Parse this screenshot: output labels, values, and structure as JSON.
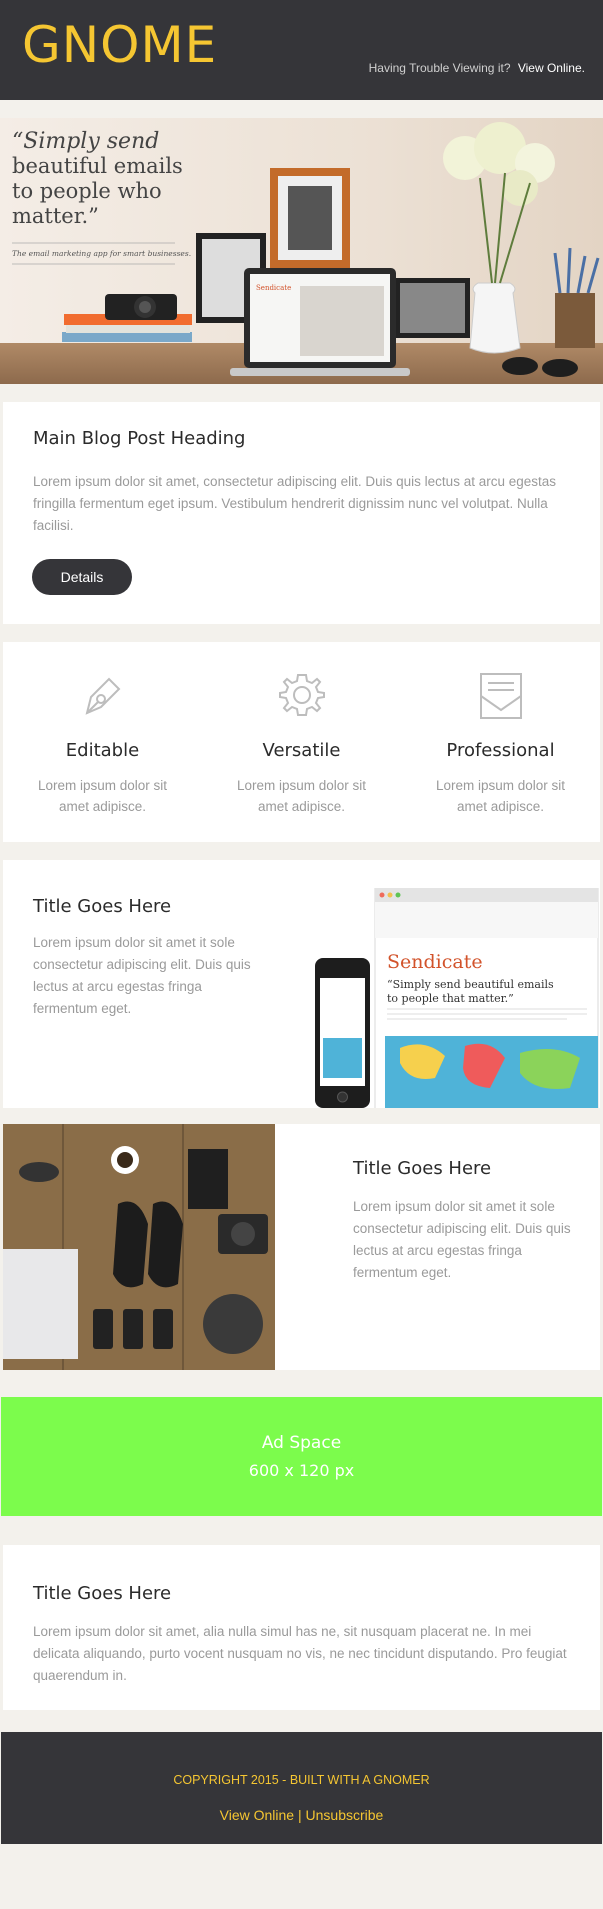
{
  "header": {
    "logo": "GNOME",
    "trouble_text": "Having Trouble Viewing it?",
    "view_online": "View Online."
  },
  "hero": {
    "quote_line1": "“Simply send",
    "quote_line2": "beautiful emails",
    "quote_line3": "to people who",
    "quote_line4": "matter.”",
    "tagline": "The email marketing app for smart businesses.",
    "screen_brand": "Sendicate"
  },
  "post": {
    "title": "Main Blog Post Heading",
    "body": "Lorem ipsum dolor sit amet, consectetur adipiscing elit. Duis quis lectus at arcu egestas fringilla fermentum eget ipsum. Vestibulum hendrerit dignissim nunc vel volutpat. Nulla facilisi.",
    "button": "Details"
  },
  "features": [
    {
      "icon": "pen-icon",
      "title": "Editable",
      "text": "Lorem ipsum dolor sit amet adipisce."
    },
    {
      "icon": "gear-icon",
      "title": "Versatile",
      "text": "Lorem ipsum dolor sit amet adipisce."
    },
    {
      "icon": "envelope-icon",
      "title": "Professional",
      "text": "Lorem ipsum dolor sit amet adipisce."
    }
  ],
  "section3": {
    "title": "Title Goes Here",
    "body": "Lorem ipsum dolor sit amet it sole consectetur adipiscing elit. Duis quis lectus at arcu egestas fringa fermentum eget.",
    "image_brand": "Sendicate",
    "image_quote1": "“Simply send beautiful emails",
    "image_quote2": "to people that matter.”"
  },
  "section4": {
    "title": "Title Goes Here",
    "body": "Lorem ipsum dolor sit amet it sole consectetur adipiscing elit. Duis quis lectus at arcu egestas fringa fermentum eget."
  },
  "ad": {
    "line1": "Ad Space",
    "line2": "600 x 120 px"
  },
  "section5": {
    "title": "Title Goes Here",
    "body": "Lorem ipsum dolor sit amet, alia nulla simul has ne, sit nusquam placerat ne. In mei delicata aliquando, purto vocent nusquam no vis, ne nec tincidunt disputando. Pro feugiat quaerendum in."
  },
  "footer": {
    "copyright": "COPYRIGHT 2015 - BUILT WITH A GNOMER",
    "view_online": "View Online",
    "separator": "|",
    "unsubscribe": "Unsubscribe"
  },
  "colors": {
    "dark": "#353539",
    "accent": "#f5c632",
    "ad_green": "#7cfc4c",
    "muted_text": "#9a9a9a"
  }
}
